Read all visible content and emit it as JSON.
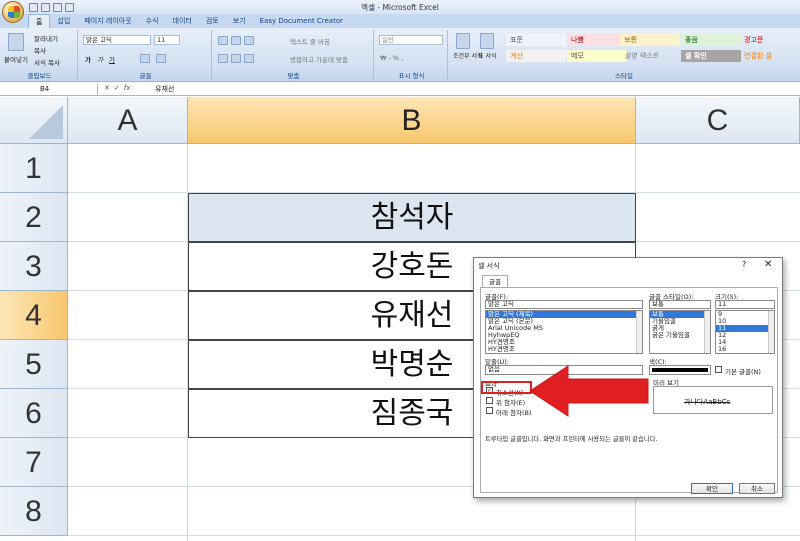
{
  "window": {
    "title": "엑셀 - Microsoft Excel"
  },
  "tabs": [
    "홈",
    "삽입",
    "페이지 레이아웃",
    "수식",
    "데이터",
    "검토",
    "보기",
    "Easy Document Creator"
  ],
  "ribbon": {
    "clipboard": {
      "paste": "붙여넣기",
      "cut": "잘라내기",
      "copy": "복사",
      "format_painter": "서식 복사",
      "label": "클립보드"
    },
    "font": {
      "name": "맑은 고딕",
      "size": "11",
      "label": "글꼴"
    },
    "alignment": {
      "wrap": "텍스트 줄 바꿈",
      "merge": "병합하고 가운데 맞춤",
      "label": "맞춤"
    },
    "number": {
      "format": "일반",
      "label": "표시 형식"
    },
    "styles": {
      "conditional": "조건부 서식",
      "table": "표 서식",
      "label": "스타일",
      "cells": [
        "표준",
        "나쁨",
        "보통",
        "좋음",
        "경고문",
        "계산",
        "메모",
        "설명 텍스트",
        "셀 확인",
        "연결된 셀"
      ]
    }
  },
  "formula_bar": {
    "name_box": "B4",
    "fx": "fx",
    "value": "유재선"
  },
  "grid": {
    "columns": [
      "A",
      "B",
      "C"
    ],
    "rows": [
      "1",
      "2",
      "3",
      "4",
      "5",
      "6",
      "7",
      "8"
    ],
    "cells": {
      "B2": "참석자",
      "B3": "강호돈",
      "B4": "유재선",
      "B5": "박명순",
      "B6": "짐종국"
    }
  },
  "dialog": {
    "title": "셀 서식",
    "help": "?",
    "close": "✕",
    "tab": "글꼴",
    "font_label": "글꼴(F):",
    "font_value": "맑은 고딕",
    "font_list": [
      "맑은 고딕 (제목)",
      "맑은 고딕 (본문)",
      "Arial Unicode MS",
      "HyhwpEQ",
      "HY견명조",
      "HY견명조"
    ],
    "style_label": "글꼴 스타일(O):",
    "style_value": "보통",
    "style_list": [
      "보통",
      "기울임꼴",
      "굵게",
      "굵은 기울임꼴"
    ],
    "size_label": "크기(S):",
    "size_value": "11",
    "size_list": [
      "9",
      "10",
      "11",
      "12",
      "14",
      "16"
    ],
    "underline_label": "밑줄(U):",
    "underline_value": "없음",
    "color_label": "색(C):",
    "normal_font": "기본 글꼴(N)",
    "effects_label": "효과",
    "strikethrough": "취소선(K)",
    "superscript": "위 첨자(E)",
    "subscript": "아래 첨자(B)",
    "preview_label": "미리 보기",
    "preview_text": "가나다AaBbCc",
    "note": "트루타입 글꼴입니다. 화면과 프린터에 사용되는 글꼴이 같습니다.",
    "ok": "확인",
    "cancel": "취소"
  },
  "colors": {
    "selection": "#f8c66d",
    "arrow": "#e02020",
    "ribbon": "#d3e1f2"
  }
}
